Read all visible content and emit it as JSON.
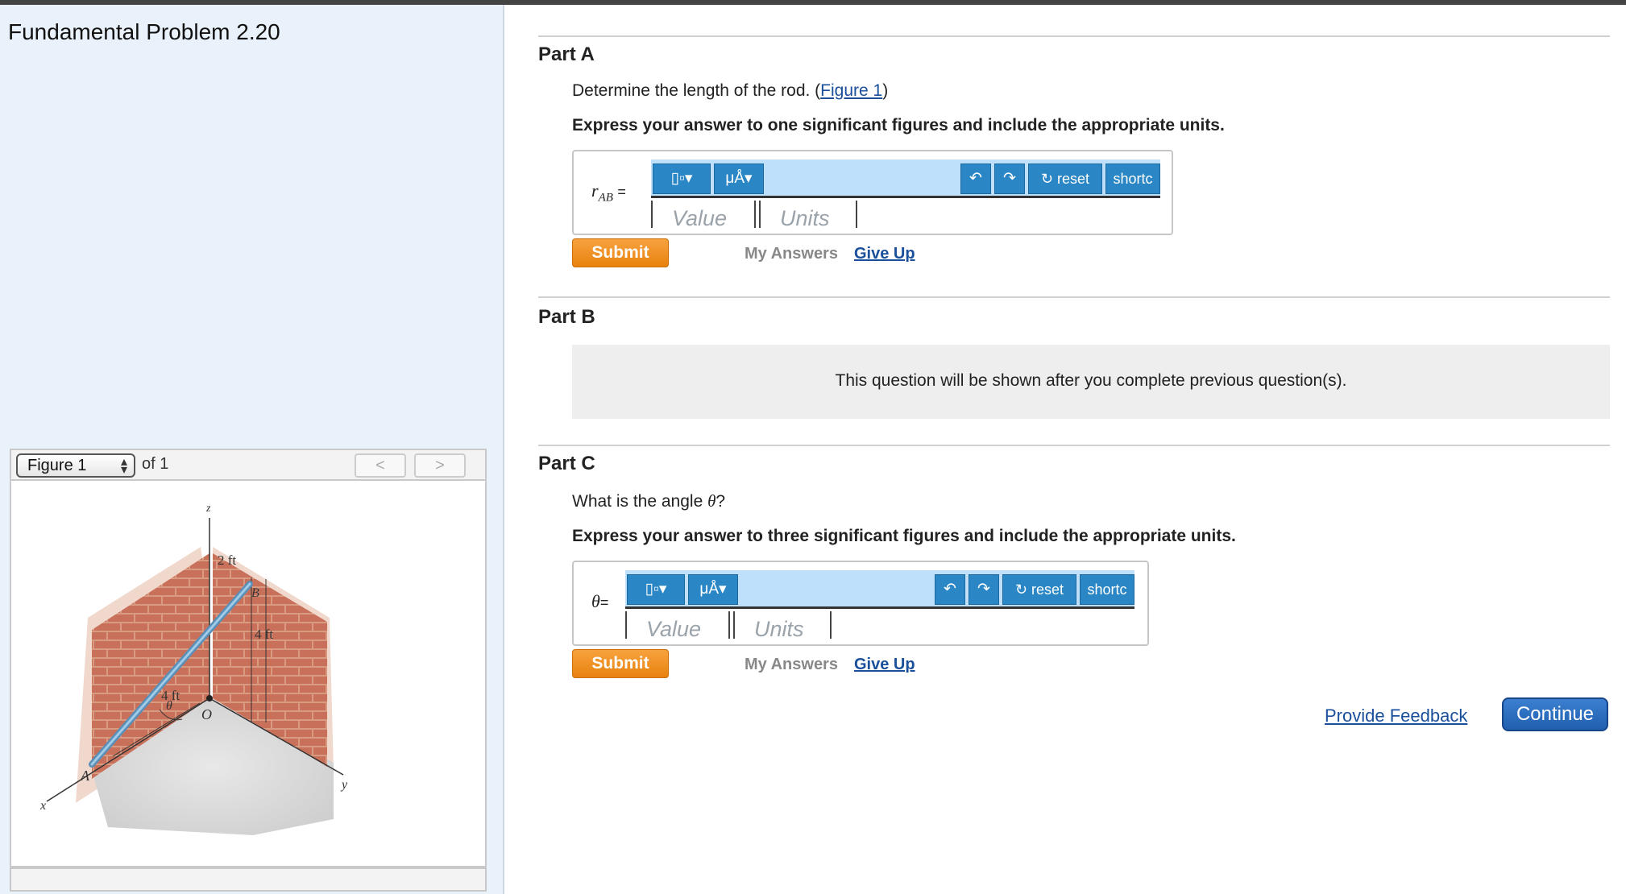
{
  "problem": {
    "title": "Fundamental Problem 2.20"
  },
  "figure_nav": {
    "selected": "Figure 1",
    "of_label": "of 1",
    "prev": "<",
    "next": ">"
  },
  "figure": {
    "labels": {
      "z": "z",
      "x": "x",
      "y": "y",
      "o": "O",
      "a": "A",
      "b": "B",
      "theta": "θ",
      "dim_2ft": "2 ft",
      "dim_4ft_vertical": "4 ft",
      "dim_4ft_floor": "4 ft"
    }
  },
  "part_a": {
    "title": "Part A",
    "question_prefix": "Determine the length of the rod. (",
    "figure_link": "Figure 1",
    "question_suffix": ")",
    "instruction": "Express your answer to one significant figures and include the appropriate units.",
    "variable": "r",
    "variable_sub": "AB",
    "equals": "=",
    "value_placeholder": "Value",
    "units_placeholder": "Units",
    "submit": "Submit",
    "my_answers": "My Answers",
    "give_up": "Give Up"
  },
  "part_b": {
    "title": "Part B",
    "locked_message": "This question will be shown after you complete previous question(s)."
  },
  "part_c": {
    "title": "Part C",
    "question_prefix": "What is the angle ",
    "question_var": "θ",
    "question_suffix": "?",
    "instruction": "Express your answer to three significant figures and include the appropriate units.",
    "variable": "θ",
    "equals": "=",
    "value_placeholder": "Value",
    "units_placeholder": "Units",
    "submit": "Submit",
    "my_answers": "My Answers",
    "give_up": "Give Up"
  },
  "toolbar": {
    "templates_icon": "templates-icon",
    "units_symbol": "μÅ",
    "undo_icon": "undo-icon",
    "redo_icon": "redo-icon",
    "reset": "reset",
    "shortcuts": "shortc"
  },
  "footer": {
    "provide_feedback": "Provide Feedback",
    "continue": "Continue"
  }
}
